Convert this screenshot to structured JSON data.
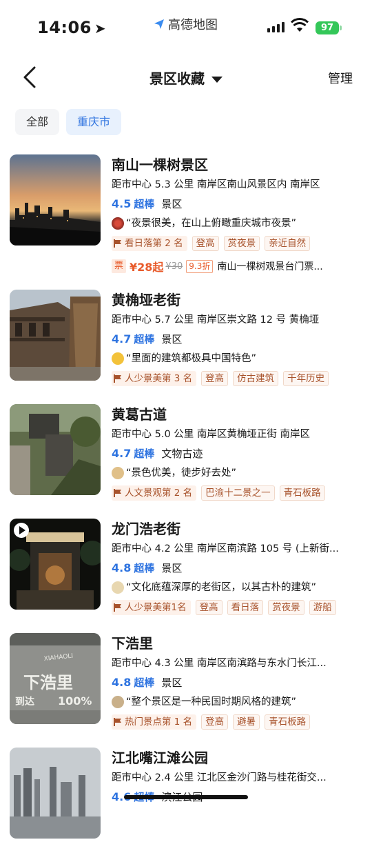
{
  "status": {
    "time": "14:06",
    "app": "高德地图",
    "battery": "97"
  },
  "nav": {
    "title": "景区收藏",
    "manage": "管理"
  },
  "filters": [
    {
      "label": "全部"
    },
    {
      "label": "重庆市"
    }
  ],
  "items": [
    {
      "name": "南山一棵树景区",
      "dist": "距市中心 5.3 公里  南岸区南山风景区内  南岸区",
      "score": "4.5",
      "level": "超棒",
      "cat": "景区",
      "review": "“夜景很美，在山上俯瞰重庆城市夜景”",
      "rank": "看日落第 2 名",
      "tags": [
        "登高",
        "赏夜景",
        "亲近自然"
      ],
      "ticket": {
        "label": "票",
        "price": "¥28起",
        "orig": "¥30",
        "disc": "9.3折",
        "desc": "南山一棵树观景台门票..."
      }
    },
    {
      "name": "黄桷垭老街",
      "dist": "距市中心 5.7 公里  南岸区崇文路 12 号  黄桷垭",
      "score": "4.7",
      "level": "超棒",
      "cat": "景区",
      "review": "“里面的建筑都极具中国特色”",
      "rank": "人少景美第 3 名",
      "tags": [
        "登高",
        "仿古建筑",
        "千年历史"
      ]
    },
    {
      "name": "黄葛古道",
      "dist": "距市中心 5.0 公里  南岸区黄桷垭正街  南岸区",
      "score": "4.7",
      "level": "超棒",
      "cat": "文物古迹",
      "review": "“景色优美，徒步好去处”",
      "rank": "人文景观第 2 名",
      "tags": [
        "巴渝十二景之一",
        "青石板路"
      ]
    },
    {
      "name": "龙门浩老街",
      "dist": "距市中心 4.2 公里  南岸区南滨路 105 号 (上新街...",
      "score": "4.8",
      "level": "超棒",
      "cat": "景区",
      "review": "“文化底蕴深厚的老街区，以其古朴的建筑”",
      "rank": "人少景美第1名",
      "tags": [
        "登高",
        "看日落",
        "赏夜景",
        "游船"
      ]
    },
    {
      "name": "下浩里",
      "dist": "距市中心 4.3 公里  南岸区南滨路与东水门长江...",
      "score": "4.8",
      "level": "超棒",
      "cat": "景区",
      "review": "“整个景区是一种民国时期风格的建筑”",
      "rank": "热门景点第 1 名",
      "tags": [
        "登高",
        "避暑",
        "青石板路"
      ],
      "thumb_text": {
        "en": "XIAHAOLI",
        "cn": "下浩里",
        "sub": "到达",
        "pct": "100%"
      }
    },
    {
      "name": "江北嘴江滩公园",
      "dist": "距市中心 2.4 公里  江北区金沙门路与桂花街交...",
      "score": "4.6",
      "level": "超棒",
      "cat": "滨江公园"
    }
  ],
  "colors": {
    "accent": "#2f74e0",
    "tag": "#a8532c",
    "price": "#e85a2a"
  }
}
